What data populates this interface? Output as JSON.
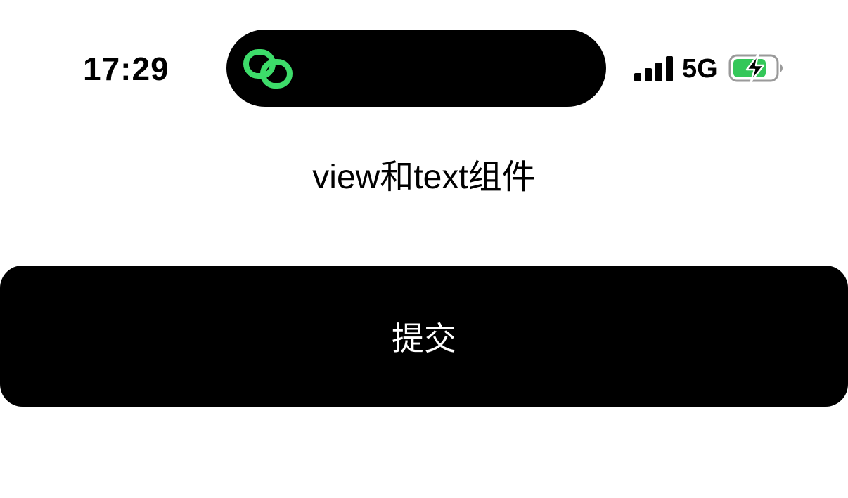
{
  "status_bar": {
    "time": "17:29",
    "network": "5G",
    "island_icon": "link-icon",
    "signal_icon": "cellular-signal-icon",
    "battery_icon": "battery-charging-icon",
    "island_accent": "#3ddc6a",
    "battery_fill": "#34c759"
  },
  "main": {
    "title": "view和text组件",
    "submit_label": "提交"
  }
}
